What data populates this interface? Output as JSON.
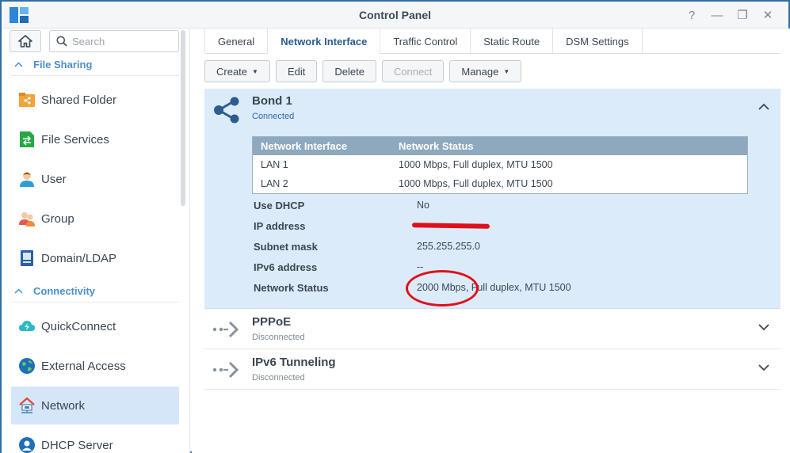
{
  "window": {
    "title": "Control Panel",
    "controls": [
      "?",
      "—",
      "❐",
      "✕"
    ]
  },
  "sidebar": {
    "search_placeholder": "Search",
    "sections": [
      {
        "label": "File Sharing",
        "items": [
          "Shared Folder",
          "File Services",
          "User",
          "Group",
          "Domain/LDAP"
        ]
      },
      {
        "label": "Connectivity",
        "items": [
          "QuickConnect",
          "External Access",
          "Network",
          "DHCP Server"
        ]
      }
    ],
    "active_item": "Network"
  },
  "tabs": [
    "General",
    "Network Interface",
    "Traffic Control",
    "Static Route",
    "DSM Settings"
  ],
  "active_tab": "Network Interface",
  "toolbar": {
    "create": "Create",
    "edit": "Edit",
    "delete": "Delete",
    "connect": "Connect",
    "manage": "Manage"
  },
  "bond": {
    "name": "Bond 1",
    "status": "Connected",
    "table": {
      "headers": [
        "Network Interface",
        "Network Status"
      ],
      "rows": [
        [
          "LAN 1",
          "1000 Mbps, Full duplex, MTU 1500"
        ],
        [
          "LAN 2",
          "1000 Mbps, Full duplex, MTU 1500"
        ]
      ]
    },
    "props": [
      {
        "label": "Use DHCP",
        "value": "No"
      },
      {
        "label": "IP address",
        "value": ""
      },
      {
        "label": "Subnet mask",
        "value": "255.255.255.0"
      },
      {
        "label": "IPv6 address",
        "value": "--"
      },
      {
        "label": "Network Status",
        "value": "2000 Mbps, Full duplex, MTU 1500"
      }
    ]
  },
  "interfaces": [
    {
      "name": "PPPoE",
      "status": "Disconnected"
    },
    {
      "name": "IPv6 Tunneling",
      "status": "Disconnected"
    }
  ],
  "colors": {
    "accent": "#4b8fcf",
    "active_bg": "#d4e6f8",
    "panel_bg": "#dcebf9",
    "annotation": "#e0101a"
  }
}
